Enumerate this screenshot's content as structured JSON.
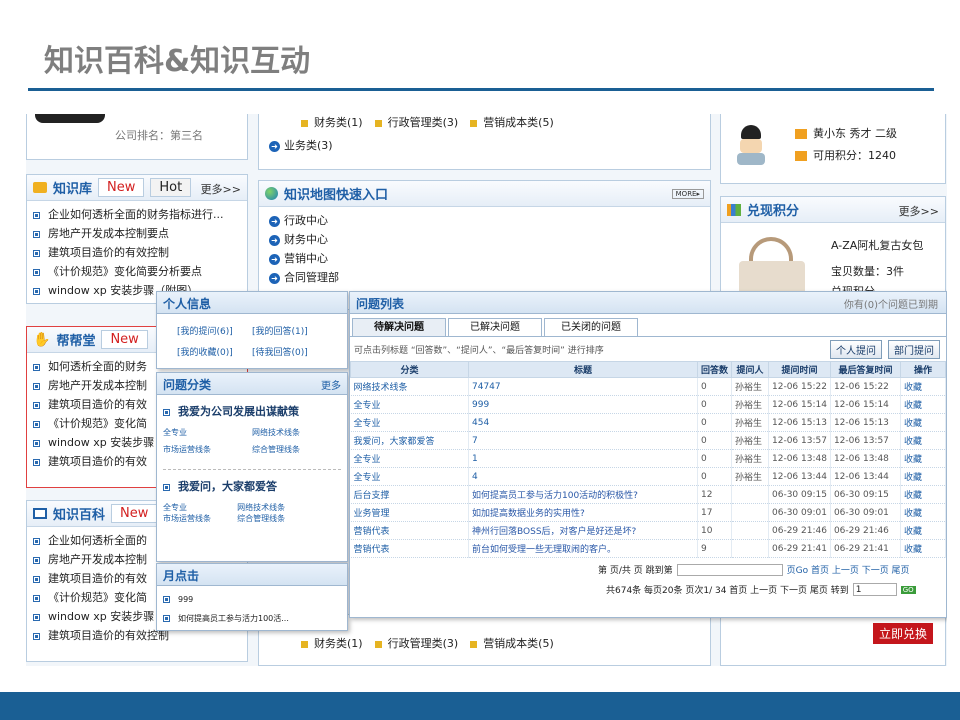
{
  "slide": {
    "title": "知识百科&知识互动"
  },
  "top_left": {
    "rank_label": "公司排名：",
    "rank_value": "第三名"
  },
  "top_center": {
    "cats": [
      "财务类(1)",
      "行政管理类(3)",
      "营销成本类(5)"
    ],
    "link": "业务类(3)"
  },
  "user_card": {
    "name": "黄小东 秀才 二级",
    "points": "可用积分：1240"
  },
  "zhishiku": {
    "title": "知识库",
    "tab_new": "New",
    "tab_hot": "Hot",
    "more": "更多>>",
    "items": [
      "企业如何透析全面的财务指标进行...",
      "房地产开发成本控制要点",
      "建筑项目造价的有效控制",
      "《计价规范》变化简要分析要点",
      "window xp 安装步骤（附图）"
    ]
  },
  "map": {
    "title": "知识地图快速入口",
    "more_badge": "MORE▸",
    "items": [
      "行政中心",
      "财务中心",
      "营销中心",
      "合同管理部"
    ]
  },
  "exchange": {
    "title": "兑现积分",
    "more": "更多>>",
    "product": "A-ZA阿札复古女包",
    "qty": "宝贝数量：3件",
    "partial": "兑现积分",
    "button": "立即兑换"
  },
  "bangbang": {
    "title": "帮帮堂",
    "tab_new": "New",
    "items": [
      "如何透析全面的财务",
      "房地产开发成本控制",
      "建筑项目造价的有效",
      "《计价规范》变化简",
      "window xp 安装步骤",
      "建筑项目造价的有效"
    ]
  },
  "baike": {
    "title": "知识百科",
    "tab_new": "New",
    "items": [
      "企业如何透析全面的",
      "房地产开发成本控制",
      "建筑项目造价的有效",
      "《计价规范》变化简",
      "window xp 安装步骤",
      "建筑项目造价的有效控制"
    ]
  },
  "bottom_center": {
    "cats": [
      "财务类(1)",
      "行政管理类(3)",
      "营销成本类(5)"
    ]
  },
  "personal": {
    "title": "个人信息",
    "links": [
      "[我的提问(6)]",
      "[我的回答(1)]",
      "[我的收藏(0)]",
      "[待我回答(0)]"
    ]
  },
  "qcat": {
    "title": "问题分类",
    "more": "更多",
    "group1": "我爱为公司发展出谋献策",
    "g1_items": [
      "全专业",
      "网络技术线条",
      "市场运营线条",
      "综合管理线条"
    ],
    "group2": "我爱问，大家都爱答",
    "g2_items": [
      "全专业",
      "网络技术线条",
      "市场运营线条",
      "综合管理线条"
    ]
  },
  "hot": {
    "title": "月点击",
    "items": [
      "999",
      "如何提高员工参与活力100活..."
    ]
  },
  "qlist": {
    "title": "问题列表",
    "notice": "你有(0)个问题已到期",
    "tabs": [
      "待解决问题",
      "已解决问题",
      "已关闭的问题"
    ],
    "hint": "可点击列标题 “回答数”、“提问人”、“最后答复时间” 进行排序",
    "btn_ask": "个人提问",
    "btn_dept": "部门提问",
    "headers": [
      "分类",
      "标题",
      "回答数",
      "提问人",
      "提问时间",
      "最后答复时间",
      "操作"
    ],
    "rows": [
      [
        "网络技术线条",
        "74747",
        "0",
        "孙裕生",
        "12-06 15:22",
        "12-06 15:22",
        "收藏"
      ],
      [
        "全专业",
        "999",
        "0",
        "孙裕生",
        "12-06 15:14",
        "12-06 15:14",
        "收藏"
      ],
      [
        "全专业",
        "454",
        "0",
        "孙裕生",
        "12-06 15:13",
        "12-06 15:13",
        "收藏"
      ],
      [
        "我爱问，大家都爱答",
        "7",
        "0",
        "孙裕生",
        "12-06 13:57",
        "12-06 13:57",
        "收藏"
      ],
      [
        "全专业",
        "1",
        "0",
        "孙裕生",
        "12-06 13:48",
        "12-06 13:48",
        "收藏"
      ],
      [
        "全专业",
        "4",
        "0",
        "孙裕生",
        "12-06 13:44",
        "12-06 13:44",
        "收藏"
      ],
      [
        "后台支撑",
        "如何提高员工参与活力100活动的积极性?",
        "12",
        "",
        "06-30 09:15",
        "06-30 09:15",
        "收藏"
      ],
      [
        "业务管理",
        "如加提高数据业务的实用性?",
        "17",
        "",
        "06-30 09:01",
        "06-30 09:01",
        "收藏"
      ],
      [
        "营销代表",
        "神州行回落BOSS后，对客户是好还是坏?",
        "10",
        "",
        "06-29 21:46",
        "06-29 21:46",
        "收藏"
      ],
      [
        "营销代表",
        "前台如何受理一些无理取闹的客户。",
        "9",
        "",
        "06-29 21:41",
        "06-29 21:41",
        "收藏"
      ]
    ],
    "pager1": "第 页/共 页 跳到第",
    "pager1_links": "页Go 首页 上一页 下一页 尾页",
    "pager2": "共674条 每页20条 页次1/ 34 首页 上一页 下一页 尾页 转到",
    "page_input": "1",
    "go": "GO"
  }
}
